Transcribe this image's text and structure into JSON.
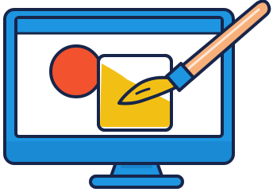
{
  "illustration": {
    "subject": "monitor-with-paintbrush",
    "colors": {
      "outline": "#17254A",
      "screen_blue": "#1E95E0",
      "screen_blue_dark": "#1576BE",
      "canvas_white": "#FFFFFF",
      "circle_red": "#F2522E",
      "paint_yellow": "#F2C014",
      "brush_handle": "#F7B07A",
      "brush_ferrule": "#1E95E0",
      "brush_tip": "#F2C014"
    },
    "icons": [
      "monitor-icon",
      "paintbrush-icon",
      "circle-shape",
      "square-canvas-icon"
    ]
  }
}
